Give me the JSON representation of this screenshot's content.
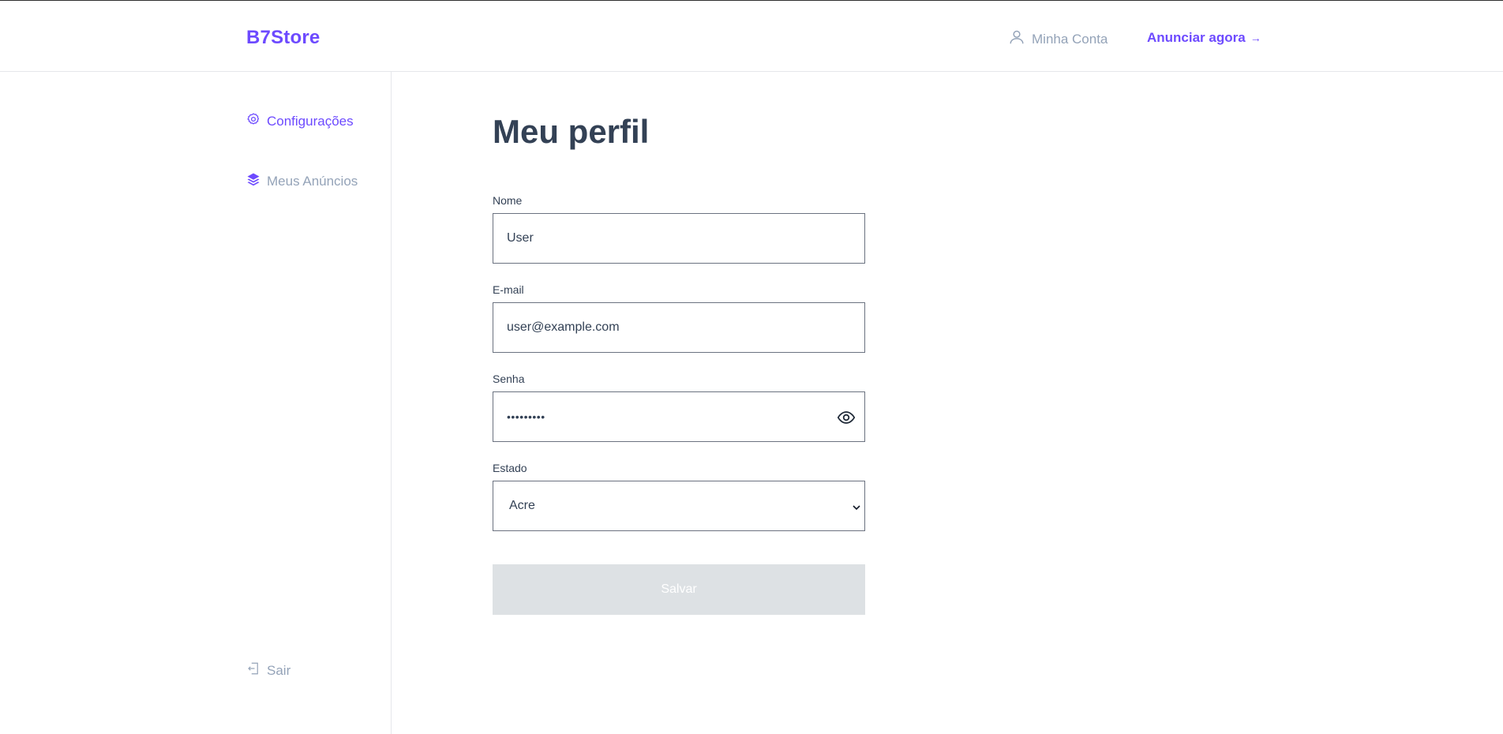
{
  "header": {
    "logo": "B7Store",
    "account_label": "Minha Conta",
    "cta_label": "Anunciar agora",
    "cta_arrow": "→"
  },
  "sidebar": {
    "items": [
      {
        "label": "Configurações",
        "icon": "gear-icon",
        "active": true
      },
      {
        "label": "Meus Anúncios",
        "icon": "layers-icon",
        "active": false
      }
    ],
    "logout_label": "Sair"
  },
  "main": {
    "title": "Meu perfil",
    "fields": {
      "name": {
        "label": "Nome",
        "value": "User"
      },
      "email": {
        "label": "E-mail",
        "value": "user@example.com"
      },
      "password": {
        "label": "Senha",
        "value": "•••••••••"
      },
      "state": {
        "label": "Estado",
        "value": "Acre"
      }
    },
    "save_label": "Salvar"
  },
  "colors": {
    "accent": "#6d4aff",
    "muted": "#94a3b8",
    "text": "#334155",
    "disabled_button": "#dde1e4"
  }
}
